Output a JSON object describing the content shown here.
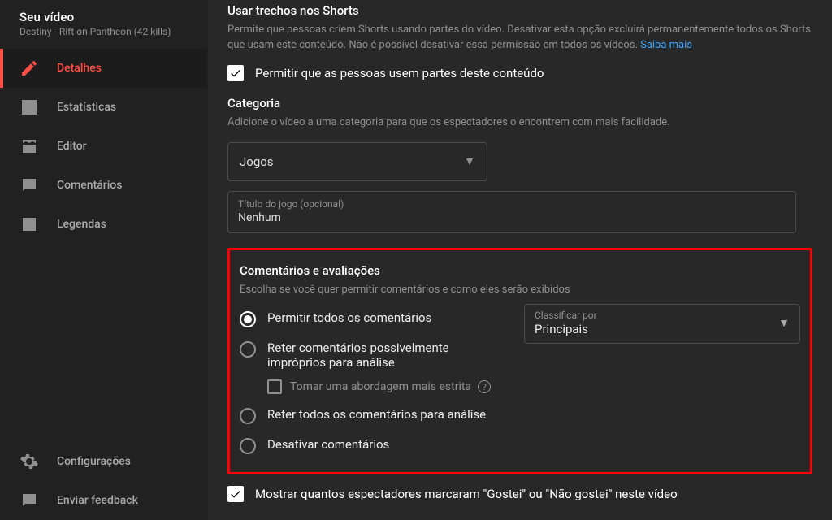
{
  "sidebar": {
    "header_title": "Seu vídeo",
    "header_subtitle": "Destiny - Rift on Pantheon (42 kills)",
    "items": [
      {
        "label": "Detalhes"
      },
      {
        "label": "Estatísticas"
      },
      {
        "label": "Editor"
      },
      {
        "label": "Comentários"
      },
      {
        "label": "Legendas"
      }
    ],
    "footer": [
      {
        "label": "Configurações"
      },
      {
        "label": "Enviar feedback"
      }
    ]
  },
  "shorts": {
    "title": "Usar trechos nos Shorts",
    "desc": "Permite que pessoas criem Shorts usando partes do vídeo. Desativar esta opção excluirá permanentemente todos os Shorts que usam este conteúdo. Não é possível desativar essa permissão em todos os vídeos. ",
    "learn_more": "Saiba mais",
    "checkbox_label": "Permitir que as pessoas usem partes deste conteúdo"
  },
  "category": {
    "title": "Categoria",
    "desc": "Adicione o vídeo a uma categoria para que os espectadores o encontrem com mais facilidade.",
    "selected": "Jogos",
    "game_title_label": "Título do jogo (opcional)",
    "game_title_value": "Nenhum"
  },
  "comments": {
    "title": "Comentários e avaliações",
    "desc": "Escolha se você quer permitir comentários e como eles serão exibidos",
    "options": [
      "Permitir todos os comentários",
      "Reter comentários possivelmente impróprios para análise",
      "Reter todos os comentários para análise",
      "Desativar comentários"
    ],
    "strict_label": "Tomar uma abordagem mais estrita",
    "sort_label": "Classificar por",
    "sort_value": "Principais",
    "show_likes_label": "Mostrar quantos espectadores marcaram \"Gostei\" ou \"Não gostei\" neste vídeo"
  }
}
